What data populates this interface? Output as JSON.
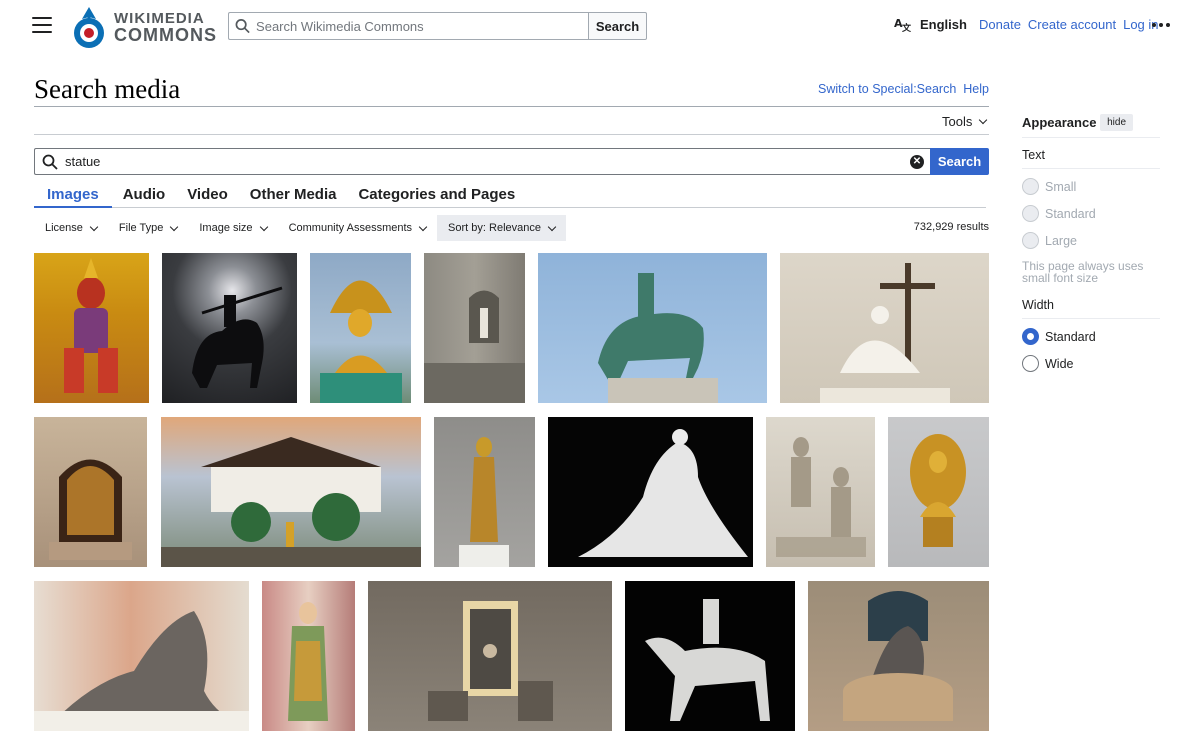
{
  "header": {
    "logo_line1": "WIKIMEDIA",
    "logo_line2": "COMMONS",
    "search_placeholder": "Search Wikimedia Commons",
    "search_button": "Search",
    "language": "English",
    "links": [
      "Donate",
      "Create account",
      "Log in"
    ]
  },
  "page": {
    "title": "Search media",
    "switch_link": "Switch to Special:Search",
    "help_link": "Help",
    "tools_label": "Tools"
  },
  "search": {
    "query": "statue",
    "button": "Search"
  },
  "tabs": [
    {
      "label": "Images",
      "active": true
    },
    {
      "label": "Audio",
      "active": false
    },
    {
      "label": "Video",
      "active": false
    },
    {
      "label": "Other Media",
      "active": false
    },
    {
      "label": "Categories and Pages",
      "active": false
    }
  ],
  "filters": [
    "License",
    "File Type",
    "Image size",
    "Community Assessments",
    "Sort by: Relevance"
  ],
  "results_count": "732,929 results",
  "appearance": {
    "title": "Appearance",
    "hide": "hide",
    "text_label": "Text",
    "text_options": [
      "Small",
      "Standard",
      "Large"
    ],
    "note": "This page always uses small font size",
    "width_label": "Width",
    "width_options": [
      "Standard",
      "Wide"
    ],
    "width_selected": "Standard"
  },
  "colors": {
    "link": "#3366cc",
    "text": "#202122",
    "border": "#a2a9b1"
  },
  "thumbnails": [
    "Golden guardian statue",
    "Silhouette equestrian statue",
    "Golden Buddha under naga",
    "Statue in stone niche",
    "Bronze equestrian statue",
    "White statue with cross",
    "Gothic shrine window",
    "Temple courtyard with statues",
    "Standing golden Buddha",
    "Kneeling white marble statue",
    "Stone relief sculpture",
    "Gilded seated Buddha",
    "Baroque sculpture group",
    "Painted saint statue",
    "Illuminated statue niche",
    "Marble equestrian statue",
    "Bronze statue on stone base"
  ]
}
